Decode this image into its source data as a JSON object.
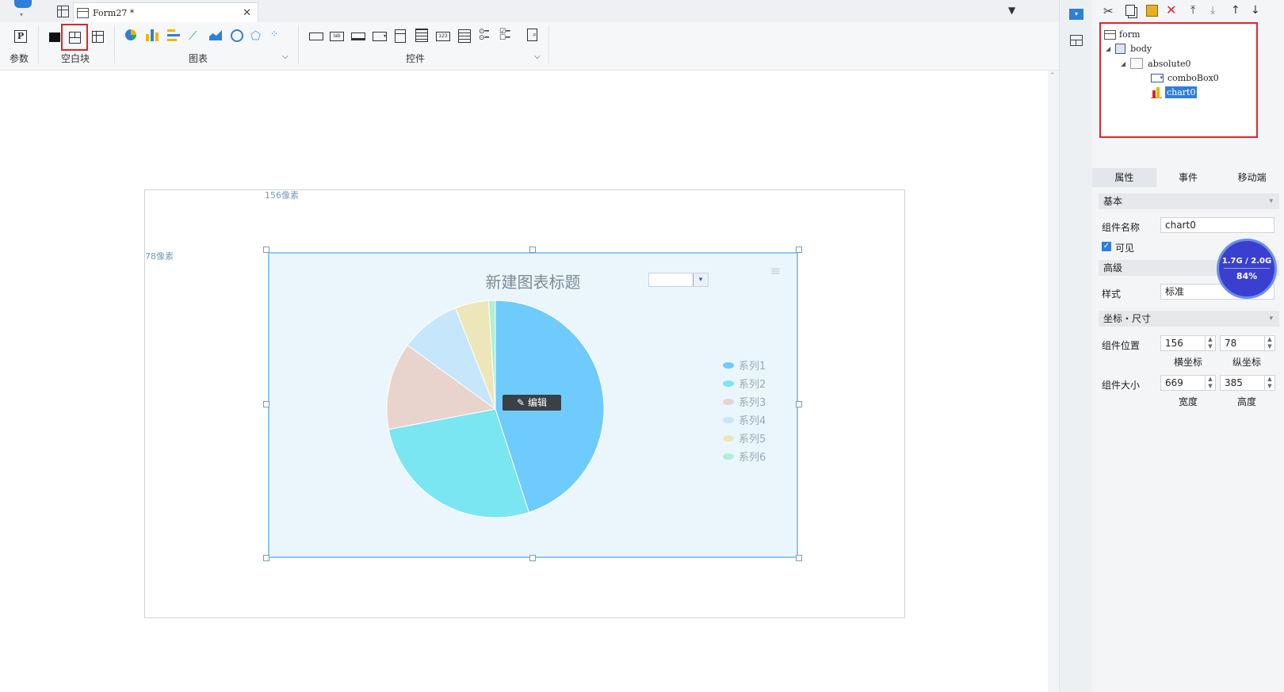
{
  "tabs": [
    {
      "label": "Form27 *"
    }
  ],
  "ribbon": {
    "params_label": "参数",
    "blank_label": "空白块",
    "chart_group_label": "图表",
    "controls_group_label": "控件"
  },
  "canvas": {
    "h_offset_label": "156像素",
    "v_offset_label": "78像素",
    "edit_label": "编辑"
  },
  "chart_data": {
    "type": "pie",
    "title": "新建图表标题",
    "series": [
      {
        "name": "系列1",
        "value": 45,
        "color": "#6ecbfc"
      },
      {
        "name": "系列2",
        "value": 27,
        "color": "#7ae6f2"
      },
      {
        "name": "系列3",
        "value": 13,
        "color": "#e8d4cc"
      },
      {
        "name": "系列4",
        "value": 9,
        "color": "#c5e6fb"
      },
      {
        "name": "系列5",
        "value": 5,
        "color": "#ede6b8"
      },
      {
        "name": "系列6",
        "value": 1,
        "color": "#b2efd3"
      }
    ],
    "legend_position": "right"
  },
  "tree": {
    "nodes": [
      "form",
      "body",
      "absolute0",
      "comboBox0",
      "chart0"
    ],
    "selected": "chart0"
  },
  "props": {
    "tabs": [
      "属性",
      "事件",
      "移动端"
    ],
    "section_basic": "基本",
    "name_label": "组件名称",
    "name_value": "chart0",
    "visible_label": "可见",
    "section_advanced": "高级",
    "style_label": "样式",
    "style_value": "标准",
    "section_coord": "坐标・尺寸",
    "pos_label": "组件位置",
    "pos_x": "156",
    "pos_y": "78",
    "pos_x_label": "横坐标",
    "pos_y_label": "纵坐标",
    "size_label": "组件大小",
    "size_w": "669",
    "size_h": "385",
    "size_w_label": "宽度",
    "size_h_label": "高度"
  },
  "memory": {
    "usage": "1.7G / 2.0G",
    "percent": "84%"
  }
}
